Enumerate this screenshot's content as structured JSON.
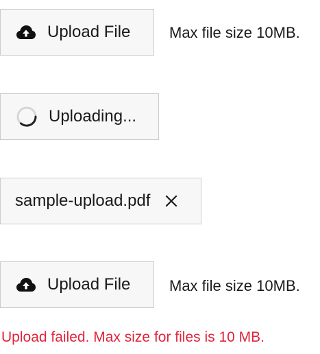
{
  "upload_idle": {
    "button_label": "Upload File",
    "icon": "cloud-upload-icon",
    "hint": "Max file size 10MB."
  },
  "upload_progress": {
    "button_label": "Uploading...",
    "icon": "spinner-icon"
  },
  "upload_done": {
    "file_name": "sample-upload.pdf",
    "remove_icon": "close-icon"
  },
  "upload_error": {
    "button_label": "Upload File",
    "icon": "cloud-upload-icon",
    "hint": "Max file size 10MB.",
    "error_message": "Upload failed. Max size for files is 10 MB."
  },
  "colors": {
    "button_bg": "#f7f7f7",
    "button_border": "#cccccc",
    "error": "#e0243a"
  }
}
